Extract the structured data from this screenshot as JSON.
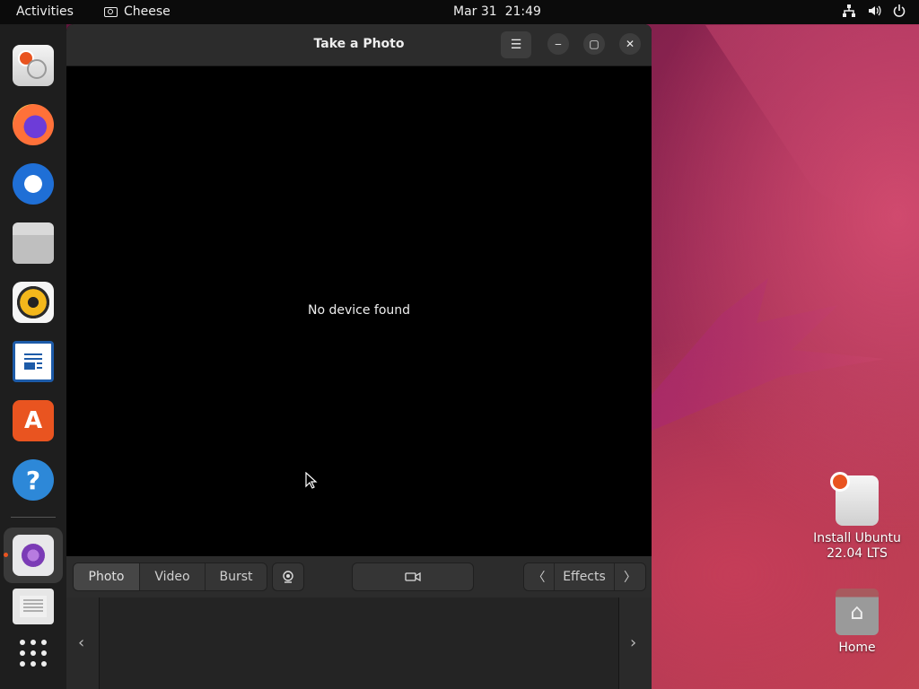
{
  "topbar": {
    "activities": "Activities",
    "app_name": "Cheese",
    "clock": "Mar 31  21:49",
    "tray_icons": [
      "network-icon",
      "volume-icon",
      "power-icon"
    ]
  },
  "dock": {
    "items": [
      {
        "name": "install-ubuntu"
      },
      {
        "name": "firefox"
      },
      {
        "name": "thunderbird"
      },
      {
        "name": "files"
      },
      {
        "name": "rhythmbox"
      },
      {
        "name": "libreoffice-writer"
      },
      {
        "name": "ubuntu-software",
        "glyph": "A"
      },
      {
        "name": "help",
        "glyph": "?"
      },
      {
        "name": "cheese",
        "running": true,
        "active": true
      },
      {
        "name": "text-editor"
      },
      {
        "name": "show-applications"
      }
    ]
  },
  "window": {
    "title": "Take a Photo",
    "menu_glyph": "☰",
    "minimize_glyph": "‒",
    "maximize_glyph": "▢",
    "close_glyph": "✕",
    "status_message": "No device found",
    "modes": [
      {
        "label": "Photo",
        "active": true
      },
      {
        "label": "Video",
        "active": false
      },
      {
        "label": "Burst",
        "active": false
      }
    ],
    "effects_label": "Effects",
    "effects_prev": "〈",
    "effects_next": "〉",
    "thumb_prev": "‹",
    "thumb_next": "›"
  },
  "desktop": {
    "icons": [
      {
        "label": "Install Ubuntu\n22.04 LTS"
      },
      {
        "label": "Home"
      }
    ]
  },
  "colors": {
    "ubuntu_orange": "#e95420",
    "headerbar": "#2c2c2c",
    "viewport": "#000000"
  }
}
